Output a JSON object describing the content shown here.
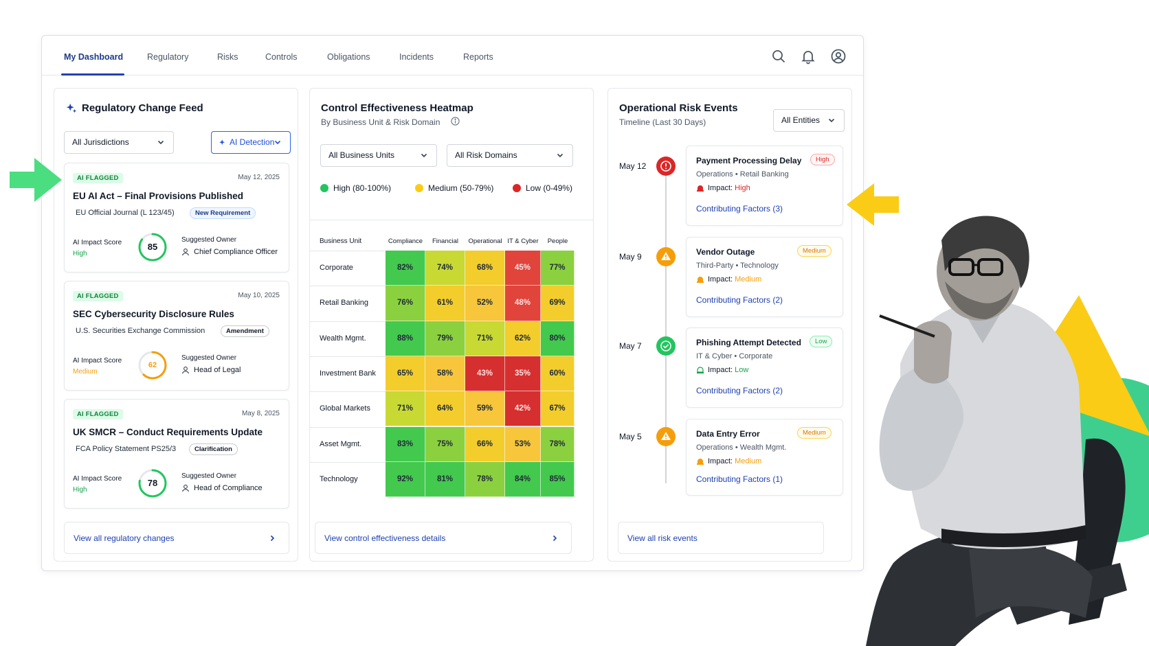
{
  "nav": {
    "tabs": [
      {
        "label": "My Dashboard"
      },
      {
        "label": "Regulatory"
      },
      {
        "label": "Risks"
      },
      {
        "label": "Controls"
      },
      {
        "label": "Obligations"
      },
      {
        "label": "Incidents"
      },
      {
        "label": "Reports"
      }
    ],
    "active_tab": "My Dashboard",
    "icons": [
      "search-icon",
      "bell-icon",
      "user-account-icon"
    ]
  },
  "regulatory": {
    "title": "Regulatory Change Feed",
    "filter_jurisdiction": "All Jurisdictions",
    "filter_ai": "AI Detection",
    "cards": [
      {
        "flag": "AI FLAGGED",
        "date": "May 12, 2025",
        "title": "EU AI Act – Final Provisions Published",
        "source": "EU Official Journal (L 123/45)",
        "tag": "New Requirement",
        "score_label": "AI Impact Score",
        "score": "85",
        "score_value": 85,
        "level": "High",
        "owner_label": "Suggested Owner",
        "owner": "Chief Compliance Officer"
      },
      {
        "flag": "AI FLAGGED",
        "date": "May 10, 2025",
        "title": "SEC Cybersecurity Disclosure Rules",
        "source": "U.S. Securities Exchange Commission",
        "tag": "Amendment",
        "score_label": "AI Impact Score",
        "score": "62",
        "score_value": 62,
        "level": "Medium",
        "owner_label": "Suggested Owner",
        "owner": "Head of Legal"
      },
      {
        "flag": "AI FLAGGED",
        "date": "May 8, 2025",
        "title": "UK SMCR – Conduct Requirements Update",
        "source": "FCA Policy Statement PS25/3",
        "tag": "Clarification",
        "score_label": "AI Impact Score",
        "score": "78",
        "score_value": 78,
        "level": "High",
        "owner_label": "Suggested Owner",
        "owner": "Head of Compliance"
      }
    ],
    "footer_link": "View all regulatory changes"
  },
  "heatmap": {
    "title": "Control Effectiveness Heatmap",
    "subtitle": "By Business Unit & Risk Domain",
    "filter_units": "All Business Units",
    "filter_domains": "All Risk Domains",
    "legend": [
      {
        "label": "High (80-100%)",
        "color": "#22c55e"
      },
      {
        "label": "Medium (50-79%)",
        "color": "#facc15"
      },
      {
        "label": "Low (0-49%)",
        "color": "#dc2626"
      }
    ],
    "row_header": "Business Unit",
    "columns": [
      "Compliance",
      "Financial",
      "Operational",
      "IT & Cyber",
      "People"
    ],
    "rows": [
      {
        "unit": "Corporate",
        "values": [
          82,
          74,
          68,
          45,
          77
        ],
        "labels": [
          "82%",
          "74%",
          "68%",
          "45%",
          "77%"
        ]
      },
      {
        "unit": "Retail Banking",
        "values": [
          76,
          61,
          52,
          48,
          69
        ],
        "labels": [
          "76%",
          "61%",
          "52%",
          "48%",
          "69%"
        ]
      },
      {
        "unit": "Wealth Mgmt.",
        "values": [
          88,
          79,
          71,
          62,
          80
        ],
        "labels": [
          "88%",
          "79%",
          "71%",
          "62%",
          "80%"
        ]
      },
      {
        "unit": "Investment Bank",
        "values": [
          65,
          58,
          43,
          35,
          60
        ],
        "labels": [
          "65%",
          "58%",
          "43%",
          "35%",
          "60%"
        ]
      },
      {
        "unit": "Global Markets",
        "values": [
          71,
          64,
          59,
          42,
          67
        ],
        "labels": [
          "71%",
          "64%",
          "59%",
          "42%",
          "67%"
        ]
      },
      {
        "unit": "Asset Mgmt.",
        "values": [
          83,
          75,
          66,
          53,
          78
        ],
        "labels": [
          "83%",
          "75%",
          "66%",
          "53%",
          "78%"
        ]
      },
      {
        "unit": "Technology",
        "values": [
          92,
          81,
          78,
          84,
          85
        ],
        "labels": [
          "92%",
          "81%",
          "78%",
          "84%",
          "85%"
        ]
      }
    ],
    "footer_link": "View control effectiveness details"
  },
  "risk_events": {
    "title": "Operational Risk Events",
    "subtitle": "Timeline (Last 30 Days)",
    "filter_entities": "All Entities",
    "impact_label": "Impact:",
    "events": [
      {
        "date": "May 12",
        "title": "Payment Processing Delay",
        "severity": "High",
        "severity_class": "high",
        "meta": "Operations • Retail Banking",
        "impact": "High",
        "factors": "Contributing Factors (3)",
        "icon": "alert-circle-icon",
        "color": "#dc2626"
      },
      {
        "date": "May 9",
        "title": "Vendor Outage",
        "severity": "Medium",
        "severity_class": "medium",
        "meta": "Third-Party • Technology",
        "impact": "Medium",
        "factors": "Contributing Factors (2)",
        "icon": "warning-triangle-icon",
        "color": "#f59e0b"
      },
      {
        "date": "May 7",
        "title": "Phishing Attempt Detected",
        "severity": "Low",
        "severity_class": "low",
        "meta": "IT & Cyber • Corporate",
        "impact": "Low",
        "factors": "Contributing Factors (2)",
        "icon": "check-circle-icon",
        "color": "#22c55e"
      },
      {
        "date": "May 5",
        "title": "Data Entry Error",
        "severity": "Medium",
        "severity_class": "medium",
        "meta": "Operations • Wealth Mgmt.",
        "impact": "Medium",
        "factors": "Contributing Factors (1)",
        "icon": "warning-triangle-icon",
        "color": "#f59e0b"
      }
    ],
    "footer_link": "View all risk events"
  },
  "colors": {
    "accent": "#1e40af",
    "green_arrow": "#4ade80",
    "yellow_arrow": "#facc15"
  }
}
